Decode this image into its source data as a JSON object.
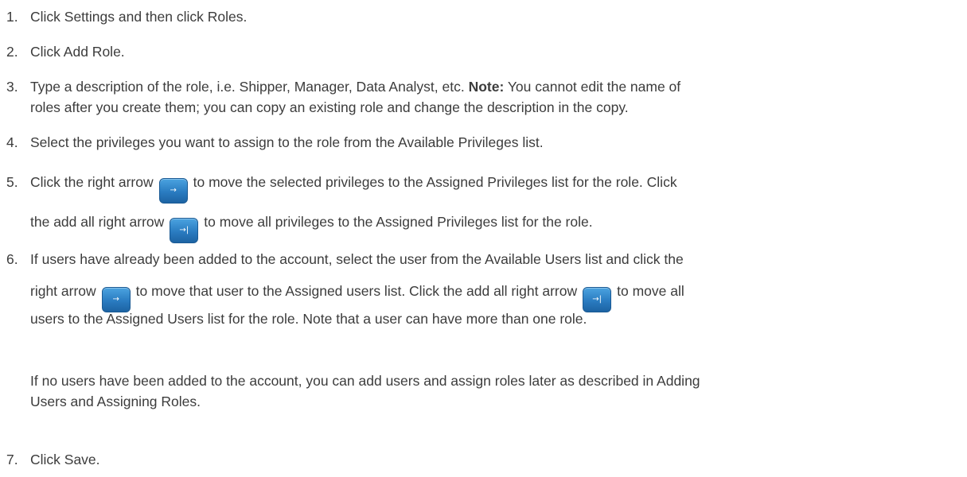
{
  "steps": [
    {
      "number": "1.",
      "text": "Click Settings and then click Roles."
    },
    {
      "number": "2.",
      "text": "Click Add Role."
    },
    {
      "number": "3.",
      "text_a": "Type a description of the role, i.e. Shipper, Manager, Data Analyst, etc. ",
      "note_label": "Note:",
      "text_b": " You cannot edit the name of",
      "text_c": "roles after you create them; you can copy an existing role and change the description in the copy."
    },
    {
      "number": "4.",
      "text": "Select the privileges you want to assign to the role from the Available Privileges list."
    },
    {
      "number": "5.",
      "text_a": "Click the right arrow",
      "text_b": "to move the selected privileges to the Assigned Privileges list for the role. Click",
      "text_c": "the add all right arrow",
      "text_d": "to move all privileges to the Assigned Privileges list for the role."
    },
    {
      "number": "6.",
      "text_a": "If users have already been added to the account, select the user from the Available Users list and click the",
      "text_b": "right arrow",
      "text_c": "to move that user to the Assigned users list. Click the add all right arrow",
      "text_d": "to move all",
      "text_e": "users to the Assigned Users list for the role. Note that a user can have more than one role.",
      "para_a": "If no users have been added to the account, you can add users and assign roles later as described in Adding",
      "para_b": "Users and Assigning Roles."
    },
    {
      "number": "7.",
      "text": "Click Save."
    }
  ],
  "icons": {
    "right_arrow": "→",
    "add_all_right_arrow": "→|",
    "button_color": "#2a7cc1"
  }
}
